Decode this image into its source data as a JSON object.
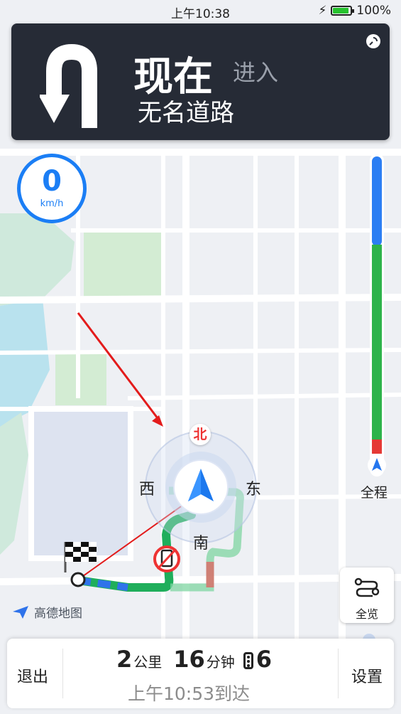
{
  "status_bar": {
    "time": "上午10:38",
    "battery": "100%"
  },
  "guidance": {
    "maneuver_icon": "u-turn-icon",
    "when": "现在",
    "action": "进入",
    "road": "无名道路"
  },
  "speed": {
    "value": "0",
    "unit": "km/h"
  },
  "compass": {
    "north": "北",
    "south": "南",
    "east": "东",
    "west": "西"
  },
  "progress": {
    "label": "全程",
    "colors": [
      "#2b7ef3",
      "#2db34a",
      "#e53935"
    ]
  },
  "overview_button": {
    "label": "全览",
    "icon": "route-icon"
  },
  "logo": {
    "text": "高德地图"
  },
  "bottom_bar": {
    "exit": "退出",
    "distance_value": "2",
    "distance_unit": "公里",
    "time_value": "16",
    "time_unit": "分钟",
    "traffic_lights_value": "6",
    "arrival": "上午10:53到达",
    "settings": "设置"
  }
}
